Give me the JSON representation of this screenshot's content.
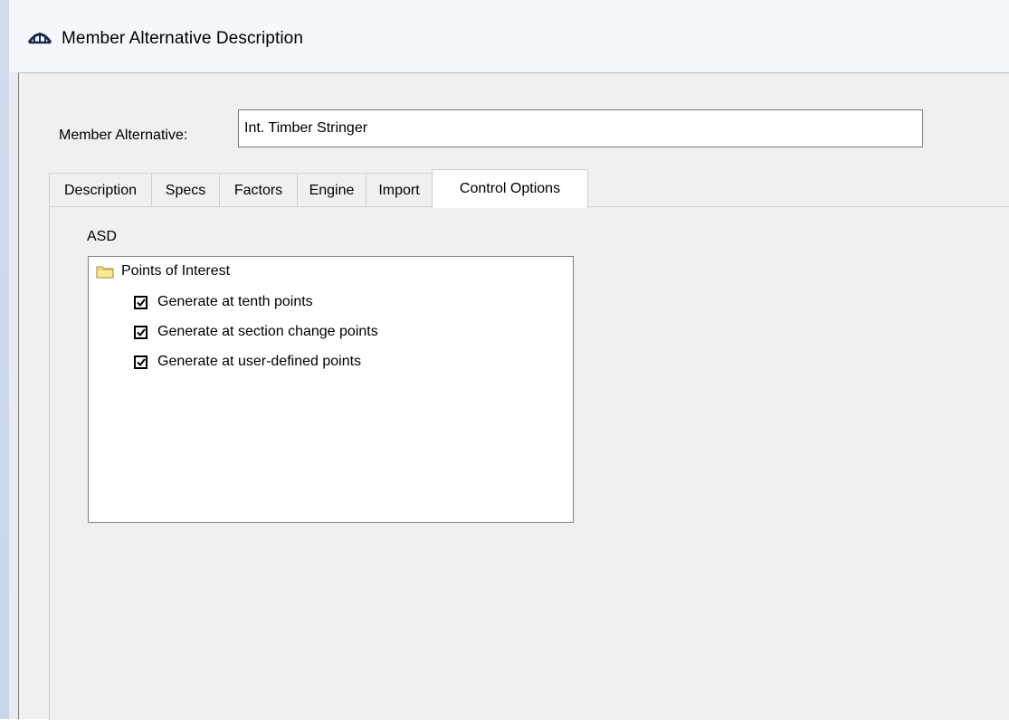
{
  "window": {
    "title": "Member Alternative Description",
    "icon": "bridge-icon"
  },
  "member_alternative": {
    "label": "Member Alternative:",
    "value": "Int. Timber Stringer"
  },
  "tabs": [
    {
      "label": "Description",
      "active": false
    },
    {
      "label": "Specs",
      "active": false
    },
    {
      "label": "Factors",
      "active": false
    },
    {
      "label": "Engine",
      "active": false
    },
    {
      "label": "Import",
      "active": false
    },
    {
      "label": "Control Options",
      "active": true
    }
  ],
  "control_options": {
    "group_label": "ASD",
    "tree": {
      "root_label": "Points of Interest",
      "root_icon": "folder-icon",
      "items": [
        {
          "label": "Generate at tenth points",
          "checked": true
        },
        {
          "label": "Generate at section change points",
          "checked": true
        },
        {
          "label": "Generate at user-defined points",
          "checked": true
        }
      ]
    }
  }
}
